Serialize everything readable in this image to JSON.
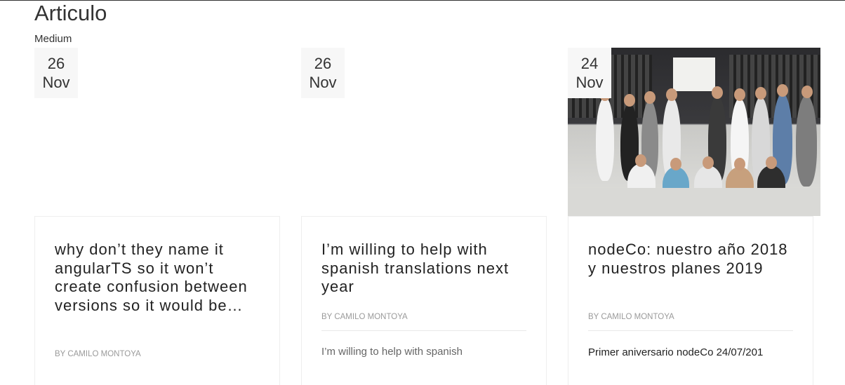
{
  "page": {
    "title": "Articulo",
    "section_label": "Medium"
  },
  "posts": [
    {
      "day": "26",
      "month": "Nov",
      "title": "why don’t they name it angularTS so it won’t create confusion between versions so it would be…",
      "byline": "BY CAMILO MONTOYA",
      "excerpt": ""
    },
    {
      "day": "26",
      "month": "Nov",
      "title": "I’m willing to help with spanish translations next year",
      "byline": "BY CAMILO MONTOYA",
      "excerpt": "I’m willing to help with spanish"
    },
    {
      "day": "24",
      "month": "Nov",
      "title": "nodeCo: nuestro año 2018 y nuestros planes 2019",
      "byline": "BY CAMILO MONTOYA",
      "excerpt": "Primer aniversario nodeCo 24/07/201"
    }
  ]
}
